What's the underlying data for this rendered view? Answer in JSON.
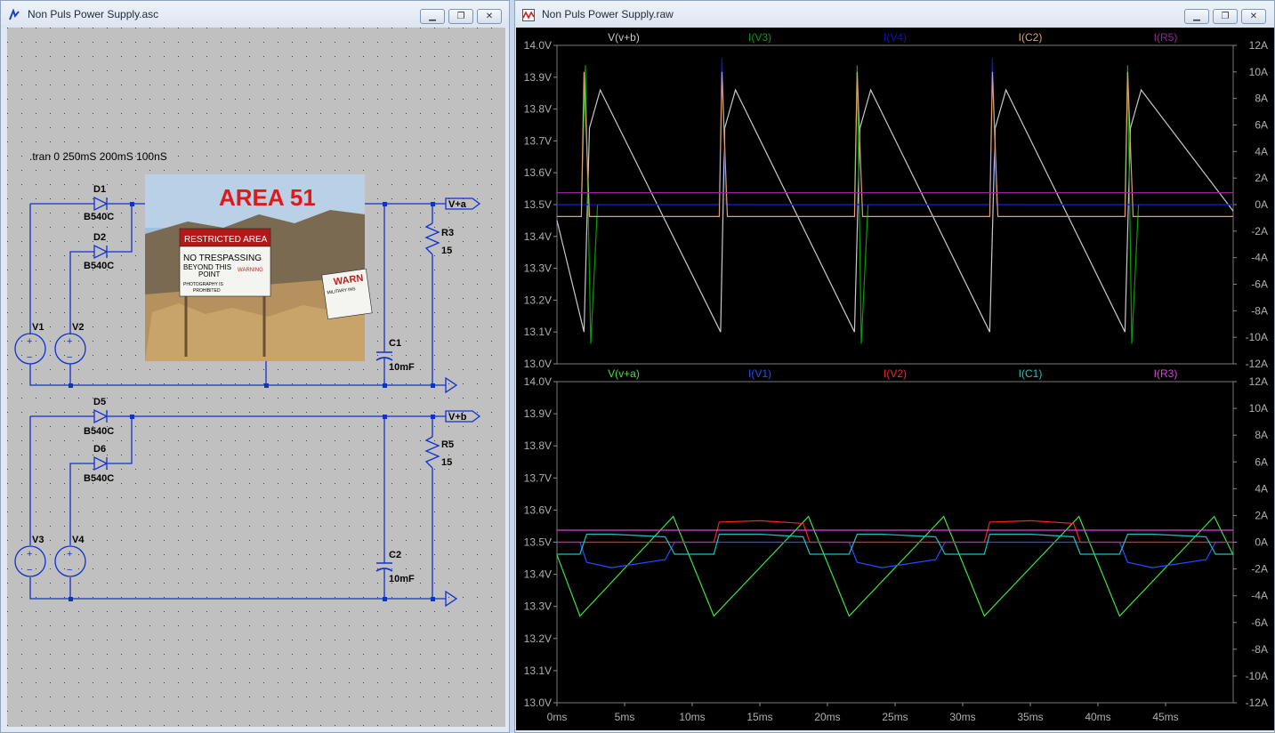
{
  "schematic_window": {
    "title": "Non Puls Power Supply.asc",
    "directive": ".tran 0 250mS 200mS 100nS",
    "image_text": {
      "headline": "AREA 51",
      "sign_top": "RESTRICTED AREA",
      "sign_line1": "NO TRESPASSING",
      "sign_line2": "BEYOND THIS",
      "sign_line3": "POINT",
      "sign_warning": "WARNING",
      "sign_line4": "PHOTOGRAPHY IS",
      "sign_line5": "PROHIBITED",
      "side_sign": "WARN",
      "side_sign2": "MILITARY INS"
    },
    "components": {
      "D1": "D1",
      "D1_model": "B540C",
      "D2": "D2",
      "D2_model": "B540C",
      "D5": "D5",
      "D5_model": "B540C",
      "D6": "D6",
      "D6_model": "B540C",
      "V1": "V1",
      "V2": "V2",
      "V3": "V3",
      "V4": "V4",
      "R3": "R3",
      "R3_value": "15",
      "R5": "R5",
      "R5_value": "15",
      "C1": "C1",
      "C1_value": "10mF",
      "C2": "C2",
      "C2_value": "10mF",
      "net_a": "V+a",
      "net_b": "V+b"
    }
  },
  "waveform_window": {
    "title": "Non Puls Power Supply.raw",
    "colors": {
      "bg": "#000000",
      "v_b": "#c8c8c8",
      "i_v3": "#00a000",
      "i_v4": "#1010d0",
      "i_c2": "#e0a070",
      "i_r5": "#a020a0",
      "v_a": "#40e040",
      "i_v1": "#2050ff",
      "i_v2": "#ff2020",
      "i_c1": "#20c0c0",
      "i_r3": "#e040e0"
    },
    "top_pane": {
      "legend": [
        "V(v+b)",
        "I(V3)",
        "I(V4)",
        "I(C2)",
        "I(R5)"
      ],
      "y_left_ticks": [
        "14.0V",
        "13.9V",
        "13.8V",
        "13.7V",
        "13.6V",
        "13.5V",
        "13.4V",
        "13.3V",
        "13.2V",
        "13.1V",
        "13.0V"
      ],
      "y_right_ticks": [
        "12A",
        "10A",
        "8A",
        "6A",
        "4A",
        "2A",
        "0A",
        "-2A",
        "-4A",
        "-6A",
        "-8A",
        "-10A",
        "-12A"
      ]
    },
    "bottom_pane": {
      "legend": [
        "V(v+a)",
        "I(V1)",
        "I(V2)",
        "I(C1)",
        "I(R3)"
      ],
      "y_left_ticks": [
        "14.0V",
        "13.9V",
        "13.8V",
        "13.7V",
        "13.6V",
        "13.5V",
        "13.4V",
        "13.3V",
        "13.2V",
        "13.1V",
        "13.0V"
      ],
      "y_right_ticks": [
        "12A",
        "10A",
        "8A",
        "6A",
        "4A",
        "2A",
        "0A",
        "-2A",
        "-4A",
        "-6A",
        "-8A",
        "-10A",
        "-12A"
      ]
    },
    "x_ticks": [
      "0ms",
      "5ms",
      "10ms",
      "15ms",
      "20ms",
      "25ms",
      "30ms",
      "35ms",
      "40ms",
      "45ms"
    ]
  },
  "chart_data": [
    {
      "type": "line",
      "title": "",
      "xlabel": "",
      "ylabel": "",
      "xlim": [
        0,
        50
      ],
      "ylim": [
        13.0,
        14.0
      ],
      "y2lim": [
        -12,
        12
      ],
      "grid": false,
      "series": [
        {
          "name": "V(v+b)",
          "axis": "left",
          "x": [
            0,
            2.0,
            2.4,
            3.2,
            12.1,
            12.4,
            13.2,
            22.0,
            22.4,
            23.2,
            32.0,
            32.4,
            33.2,
            42.0,
            42.4,
            43.2,
            50
          ],
          "y": [
            13.45,
            13.1,
            13.74,
            13.86,
            13.1,
            13.74,
            13.86,
            13.1,
            13.74,
            13.86,
            13.1,
            13.74,
            13.86,
            13.1,
            13.74,
            13.86,
            13.48
          ]
        },
        {
          "name": "I(V3)",
          "axis": "right",
          "x": [
            0,
            1.8,
            2.1,
            2.5,
            3.0,
            12.0,
            12.2,
            12.5,
            13.0,
            22.0,
            22.2,
            22.5,
            23.0,
            32.0,
            32.2,
            32.5,
            33.0,
            42.0,
            42.2,
            42.5,
            43.0,
            50
          ],
          "y": [
            0,
            0,
            10.5,
            -10.5,
            0,
            0,
            10.5,
            0,
            0,
            0,
            10.5,
            -10.5,
            0,
            0,
            10.5,
            0,
            0,
            0,
            10.5,
            -10.5,
            0,
            0
          ]
        },
        {
          "name": "I(V4)",
          "axis": "right",
          "x": [
            0,
            12.0,
            12.2,
            12.5,
            32.0,
            32.2,
            32.5,
            50
          ],
          "y": [
            0,
            0,
            11,
            0,
            0,
            11,
            0,
            0
          ]
        },
        {
          "name": "I(C2)",
          "axis": "right",
          "x": [
            0,
            1.8,
            2.0,
            2.4,
            3.0,
            12.0,
            12.2,
            12.6,
            13.0,
            22.0,
            22.2,
            22.6,
            23.0,
            32.0,
            32.2,
            32.6,
            33.0,
            42.0,
            42.2,
            42.6,
            43.0,
            50
          ],
          "y": [
            -0.9,
            -0.9,
            10,
            -0.9,
            -0.9,
            -0.9,
            10,
            -0.9,
            -0.9,
            -0.9,
            10,
            -0.9,
            -0.9,
            -0.9,
            10,
            -0.9,
            -0.9,
            -0.9,
            10,
            -0.9,
            -0.9,
            -0.9
          ]
        },
        {
          "name": "I(R5)",
          "axis": "right",
          "x": [
            0,
            50
          ],
          "y": [
            0.9,
            0.9
          ]
        }
      ]
    },
    {
      "type": "line",
      "title": "",
      "xlabel": "",
      "ylabel": "",
      "xlim": [
        0,
        50
      ],
      "ylim": [
        13.0,
        14.0
      ],
      "y2lim": [
        -12,
        12
      ],
      "grid": false,
      "series": [
        {
          "name": "V(v+a)",
          "axis": "left",
          "x": [
            0,
            1.7,
            8.6,
            11.6,
            18.6,
            21.6,
            28.6,
            31.6,
            38.6,
            41.6,
            48.6,
            50
          ],
          "y": [
            13.46,
            13.27,
            13.58,
            13.27,
            13.58,
            13.27,
            13.58,
            13.27,
            13.58,
            13.27,
            13.58,
            13.46
          ]
        },
        {
          "name": "I(V1)",
          "axis": "right",
          "x": [
            0,
            1.7,
            2.2,
            4.0,
            8.0,
            8.7,
            21.6,
            22.2,
            24.0,
            28.0,
            28.7,
            41.6,
            42.2,
            44.0,
            48.0,
            48.7,
            50
          ],
          "y": [
            0,
            0,
            -1.5,
            -1.9,
            -1.3,
            0,
            0,
            -1.5,
            -1.9,
            -1.3,
            0,
            0,
            -1.5,
            -1.9,
            -1.3,
            0,
            0
          ]
        },
        {
          "name": "I(V2)",
          "axis": "right",
          "x": [
            0,
            11.6,
            12.0,
            15.0,
            18.2,
            18.7,
            31.6,
            32.0,
            35.0,
            38.2,
            38.7,
            50
          ],
          "y": [
            0,
            0,
            1.5,
            1.6,
            1.4,
            0,
            0,
            1.5,
            1.6,
            1.4,
            0,
            0
          ]
        },
        {
          "name": "I(C1)",
          "axis": "right",
          "x": [
            0,
            1.7,
            2.2,
            4.0,
            8.0,
            8.7,
            11.6,
            12.0,
            15.0,
            18.2,
            18.7,
            21.6,
            22.2,
            24.0,
            28.0,
            28.7,
            31.6,
            32.0,
            35.0,
            38.2,
            38.7,
            41.6,
            42.2,
            44.0,
            48.0,
            48.7,
            50
          ],
          "y": [
            -0.9,
            -0.9,
            0.6,
            0.6,
            0.4,
            -0.9,
            -0.9,
            0.6,
            0.6,
            0.4,
            -0.9,
            -0.9,
            0.6,
            0.6,
            0.4,
            -0.9,
            -0.9,
            0.6,
            0.6,
            0.4,
            -0.9,
            -0.9,
            0.6,
            0.6,
            0.4,
            -0.9,
            -0.9
          ]
        },
        {
          "name": "I(R3)",
          "axis": "right",
          "x": [
            0,
            50
          ],
          "y": [
            0.9,
            0.9
          ]
        }
      ]
    }
  ]
}
